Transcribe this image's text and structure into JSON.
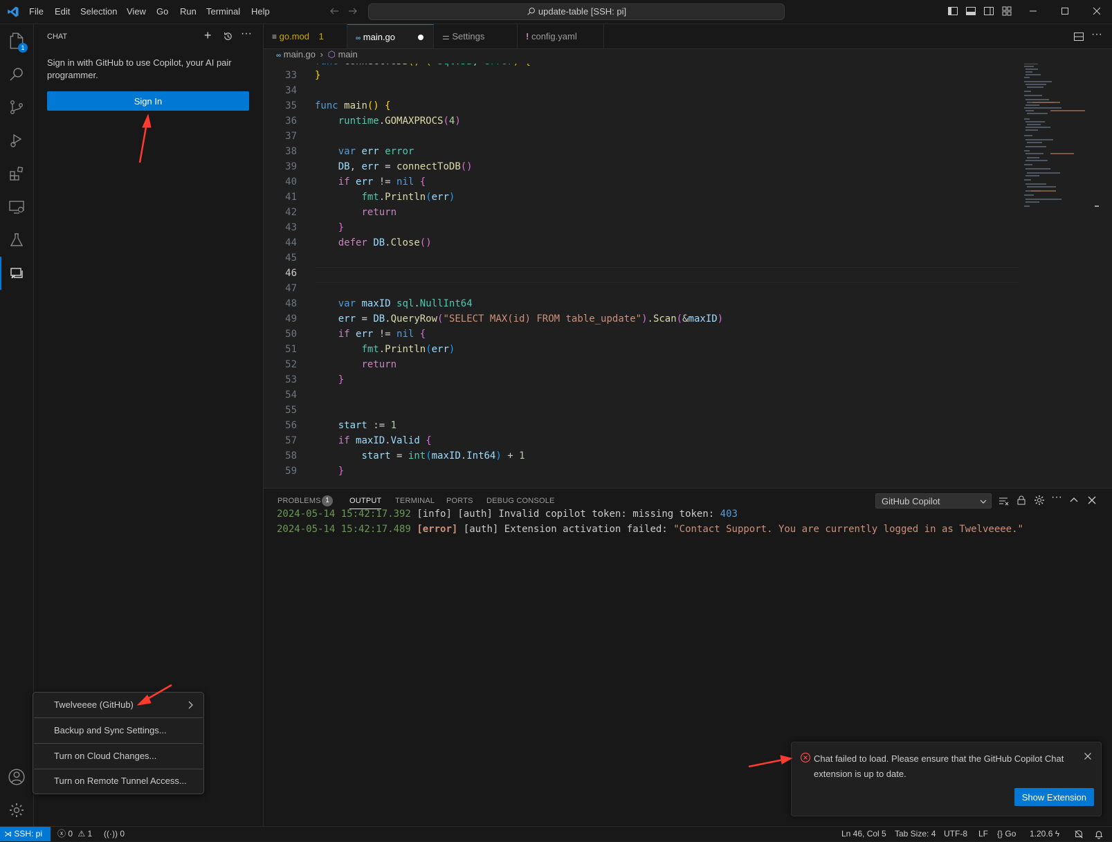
{
  "titlebar": {
    "menus": [
      "File",
      "Edit",
      "Selection",
      "View",
      "Go",
      "Run",
      "Terminal",
      "Help"
    ],
    "command_center": "update-table [SSH: pi]"
  },
  "activity": {
    "explorer_badge": "1"
  },
  "chat": {
    "title": "CHAT",
    "message": "Sign in with GitHub to use Copilot, your AI pair programmer.",
    "signin_label": "Sign In"
  },
  "account_menu": {
    "items": [
      "Twelveeee (GitHub)",
      "Backup and Sync Settings...",
      "Turn on Cloud Changes...",
      "Turn on Remote Tunnel Access..."
    ]
  },
  "tabs": [
    {
      "label": "go.mod",
      "badge": "1"
    },
    {
      "label": "main.go"
    },
    {
      "label": "Settings"
    },
    {
      "label": "config.yaml"
    }
  ],
  "breadcrumb": {
    "file": "main.go",
    "symbol": "main"
  },
  "code": {
    "lines": [
      "33",
      "34",
      "35",
      "36",
      "37",
      "38",
      "39",
      "40",
      "41",
      "42",
      "43",
      "44",
      "45",
      "46",
      "47",
      "48",
      "49",
      "50",
      "51",
      "52",
      "53",
      "54",
      "55",
      "56",
      "57",
      "58",
      "59"
    ]
  },
  "panel": {
    "tabs": [
      "PROBLEMS",
      "OUTPUT",
      "TERMINAL",
      "PORTS",
      "DEBUG CONSOLE"
    ],
    "problems_count": "1",
    "output_channel": "GitHub Copilot",
    "log": [
      {
        "time": "2024-05-14 15:42:17.392",
        "level": "[info]",
        "source": "[auth]",
        "msg": "Invalid copilot token: missing token:",
        "code": "403"
      },
      {
        "time": "2024-05-14 15:42:17.489",
        "level": "[error]",
        "source": "[auth]",
        "msg": "Extension activation failed:",
        "quoted": "\"Contact Support. You are currently logged in as Twelveeee.\""
      }
    ]
  },
  "notification": {
    "message": "Chat failed to load. Please ensure that the GitHub Copilot Chat extension is up to date.",
    "action": "Show Extension"
  },
  "statusbar": {
    "remote": "SSH: pi",
    "errors": "0",
    "warnings": "1",
    "ports": "0",
    "position": "Ln 46, Col 5",
    "tab_size": "Tab Size: 4",
    "encoding": "UTF-8",
    "eol": "LF",
    "language": "Go",
    "go_version": "1.20.6"
  },
  "colors": {
    "accent": "#0078d4",
    "annotation": "#ff3b30"
  }
}
